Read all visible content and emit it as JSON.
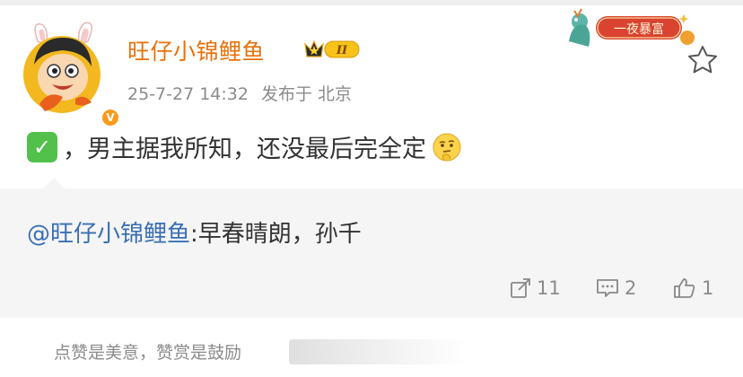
{
  "post": {
    "username": "旺仔小锦鲤鱼",
    "level_badge": "II",
    "timestamp": "25-7-27 14:32",
    "location": "发布于 北京",
    "text": "，男主据我所知，还没最后完全定",
    "decoration_label": "一夜暴富"
  },
  "repost": {
    "mention": "@旺仔小锦鲤鱼",
    "text": ":早春晴朗，孙千"
  },
  "actions": {
    "forward_count": "11",
    "comment_count": "2",
    "like_count": "1"
  },
  "footer": {
    "reward_text": "点赞是美意，赞赏是鼓励"
  },
  "icons": {
    "check": "check-mark-emoji-icon",
    "think": "thinking-face-emoji-icon",
    "favorite": "star-outline-icon",
    "forward": "forward-icon",
    "comment": "comment-icon",
    "like": "thumb-up-icon"
  },
  "colors": {
    "username": "#e8710a",
    "mention": "#3a6fb5",
    "meta": "#8b8b8b",
    "repost_bg": "#f5f5f5"
  }
}
